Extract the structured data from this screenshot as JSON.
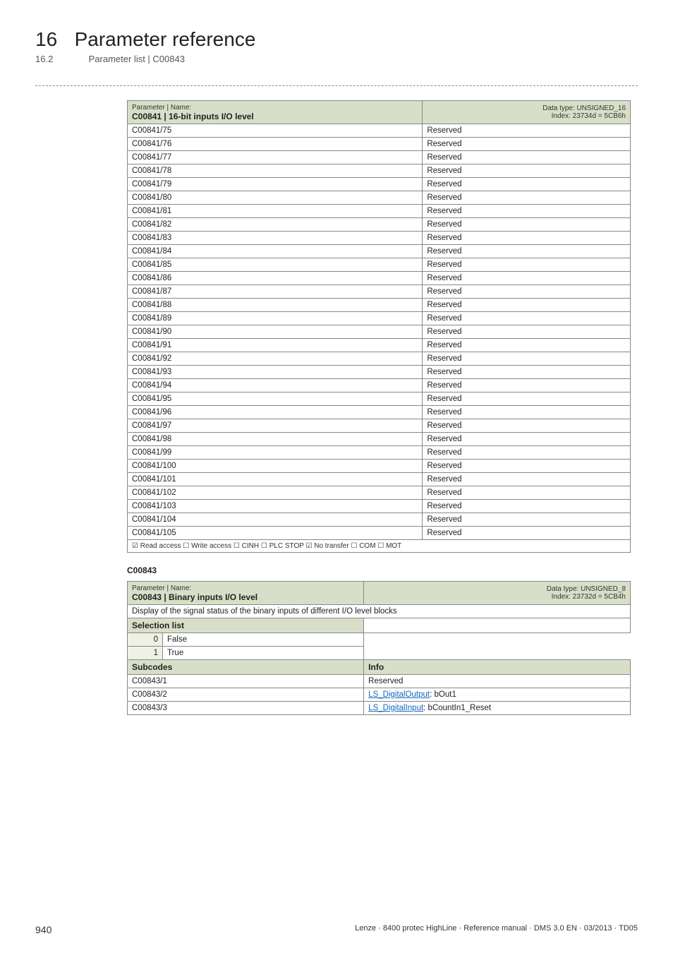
{
  "header": {
    "chapter_num": "16",
    "chapter_title": "Parameter reference",
    "section_num": "16.2",
    "section_title": "Parameter list | C00843"
  },
  "table1": {
    "param_label": "Parameter | Name:",
    "param_name": "C00841 | 16-bit inputs I/O level",
    "dtype_line1": "Data type: UNSIGNED_16",
    "dtype_line2": "Index: 23734d = 5CB6h",
    "rows": [
      {
        "code": "C00841/75",
        "val": "Reserved"
      },
      {
        "code": "C00841/76",
        "val": "Reserved"
      },
      {
        "code": "C00841/77",
        "val": "Reserved"
      },
      {
        "code": "C00841/78",
        "val": "Reserved"
      },
      {
        "code": "C00841/79",
        "val": "Reserved"
      },
      {
        "code": "C00841/80",
        "val": "Reserved"
      },
      {
        "code": "C00841/81",
        "val": "Reserved"
      },
      {
        "code": "C00841/82",
        "val": "Reserved"
      },
      {
        "code": "C00841/83",
        "val": "Reserved"
      },
      {
        "code": "C00841/84",
        "val": "Reserved"
      },
      {
        "code": "C00841/85",
        "val": "Reserved"
      },
      {
        "code": "C00841/86",
        "val": "Reserved"
      },
      {
        "code": "C00841/87",
        "val": "Reserved"
      },
      {
        "code": "C00841/88",
        "val": "Reserved"
      },
      {
        "code": "C00841/89",
        "val": "Reserved"
      },
      {
        "code": "C00841/90",
        "val": "Reserved"
      },
      {
        "code": "C00841/91",
        "val": "Reserved"
      },
      {
        "code": "C00841/92",
        "val": "Reserved"
      },
      {
        "code": "C00841/93",
        "val": "Reserved"
      },
      {
        "code": "C00841/94",
        "val": "Reserved"
      },
      {
        "code": "C00841/95",
        "val": "Reserved"
      },
      {
        "code": "C00841/96",
        "val": "Reserved"
      },
      {
        "code": "C00841/97",
        "val": "Reserved"
      },
      {
        "code": "C00841/98",
        "val": "Reserved"
      },
      {
        "code": "C00841/99",
        "val": "Reserved"
      },
      {
        "code": "C00841/100",
        "val": "Reserved"
      },
      {
        "code": "C00841/101",
        "val": "Reserved"
      },
      {
        "code": "C00841/102",
        "val": "Reserved"
      },
      {
        "code": "C00841/103",
        "val": "Reserved"
      },
      {
        "code": "C00841/104",
        "val": "Reserved"
      },
      {
        "code": "C00841/105",
        "val": "Reserved"
      }
    ],
    "footer": "☑ Read access   ☐ Write access   ☐ CINH   ☐ PLC STOP   ☑ No transfer   ☐ COM   ☐ MOT"
  },
  "section_label": "C00843",
  "table2": {
    "param_label": "Parameter | Name:",
    "param_name": "C00843 | Binary inputs I/O level",
    "dtype_line1": "Data type: UNSIGNED_8",
    "dtype_line2": "Index: 23732d = 5CB4h",
    "desc": "Display of the signal status of the binary inputs of different I/O level blocks",
    "selection_label": "Selection list",
    "selections": [
      {
        "num": "0",
        "val": "False"
      },
      {
        "num": "1",
        "val": "True"
      }
    ],
    "subcodes_label": "Subcodes",
    "info_label": "Info",
    "subcodes": [
      {
        "code": "C00843/1",
        "info_text": "Reserved",
        "link": ""
      },
      {
        "code": "C00843/2",
        "info_text": ": bOut1",
        "link": "LS_DigitalOutput"
      },
      {
        "code": "C00843/3",
        "info_text": ": bCountIn1_Reset",
        "link": "LS_DigitalInput"
      }
    ]
  },
  "footer": {
    "page": "940",
    "text": "Lenze · 8400 protec HighLine · Reference manual · DMS 3.0 EN · 03/2013 · TD05"
  }
}
